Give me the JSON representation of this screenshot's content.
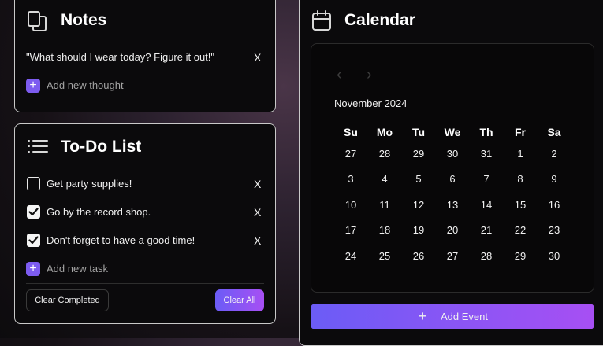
{
  "notes": {
    "title": "Notes",
    "items": [
      {
        "text": "\"What should I wear today? Figure it out!\"",
        "remove_label": "X"
      }
    ],
    "add_label": "Add new thought"
  },
  "todo": {
    "title": "To-Do List",
    "items": [
      {
        "text": "Get party supplies!",
        "checked": false,
        "remove_label": "X"
      },
      {
        "text": "Go by the record shop.",
        "checked": true,
        "remove_label": "X"
      },
      {
        "text": "Don't forget to have a good time!",
        "checked": true,
        "remove_label": "X"
      }
    ],
    "add_label": "Add new task",
    "clear_completed_label": "Clear Completed",
    "clear_all_label": "Clear All"
  },
  "calendar": {
    "title": "Calendar",
    "month_label": "November 2024",
    "prev_icon": "chevron-left-icon",
    "next_icon": "chevron-right-icon",
    "weekdays": [
      "Su",
      "Mo",
      "Tu",
      "We",
      "Th",
      "Fr",
      "Sa"
    ],
    "weeks": [
      [
        "27",
        "28",
        "29",
        "30",
        "31",
        "1",
        "2"
      ],
      [
        "3",
        "4",
        "5",
        "6",
        "7",
        "8",
        "9"
      ],
      [
        "10",
        "11",
        "12",
        "13",
        "14",
        "15",
        "16"
      ],
      [
        "17",
        "18",
        "19",
        "20",
        "21",
        "22",
        "23"
      ],
      [
        "24",
        "25",
        "26",
        "27",
        "28",
        "29",
        "30"
      ]
    ],
    "add_event_label": "Add Event"
  },
  "colors": {
    "accent_purple": "#7d5cf0",
    "gradient_start": "#6b5cf6",
    "gradient_end": "#a74ff3",
    "panel_bg": "#0b0a0c",
    "panel_border": "#c9c9c9"
  }
}
